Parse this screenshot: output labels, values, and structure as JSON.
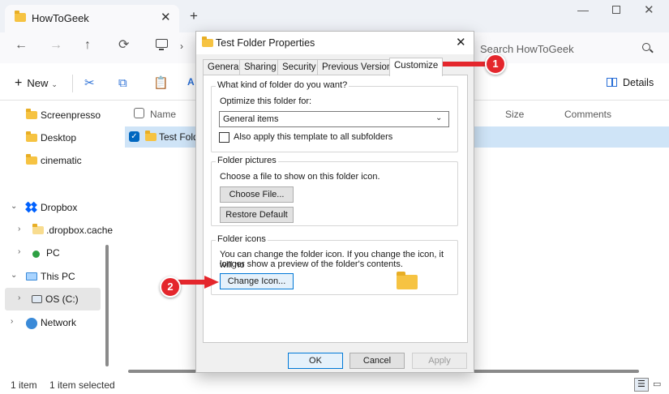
{
  "explorer": {
    "tab_title": "HowToGeek",
    "tab_close": "✕",
    "new_tab": "+",
    "window_controls": {
      "minimize": "—",
      "close": "✕"
    },
    "nav": {
      "back": "←",
      "forward": "→",
      "up": "↑",
      "refresh": "⟳",
      "breadcrumb_chevron": "›"
    },
    "search_placeholder": "Search HowToGeek",
    "toolbar": {
      "new_label": "New",
      "new_plus": "+",
      "new_caret": "⌄",
      "cut": "✂",
      "copy": "⧉",
      "paste": "📋",
      "rename": "A",
      "details_label": "Details"
    },
    "sidebar": [
      {
        "label": "Screenpresso",
        "icon": "folder-icon"
      },
      {
        "label": "Desktop",
        "icon": "folder-icon"
      },
      {
        "label": "cinematic",
        "icon": "folder-icon"
      },
      {
        "label": "Dropbox",
        "icon": "dropbox-icon",
        "chevron": "⌄"
      },
      {
        "label": ".dropbox.cache",
        "icon": "folder-icon",
        "chevron": "›"
      },
      {
        "label": "PC",
        "icon": "pc-icon",
        "chevron": "›"
      },
      {
        "label": "This PC",
        "icon": "computer-icon",
        "chevron": "⌄"
      },
      {
        "label": "OS (C:)",
        "icon": "drive-icon",
        "chevron": "›"
      },
      {
        "label": "Network",
        "icon": "network-icon",
        "chevron": "›"
      }
    ],
    "columns": {
      "name": "Name",
      "size": "Size",
      "comments": "Comments"
    },
    "rows": [
      {
        "name": "Test Folder",
        "checked": "✓"
      }
    ],
    "status": {
      "count": "1 item",
      "selected": "1 item selected"
    },
    "colors": {
      "accent": "#0067c0",
      "selection": "#cfe4f7",
      "folder": "#f6c342"
    }
  },
  "dialog": {
    "title": "Test Folder Properties",
    "close": "✕",
    "tabs": [
      "General",
      "Sharing",
      "Security",
      "Previous Versions",
      "Customize"
    ],
    "active_tab": "Customize",
    "folder_type": {
      "label": "What kind of folder do you want?",
      "optimize_label": "Optimize this folder for:",
      "selected": "General items",
      "caret": "⌄",
      "subfolders_checkbox": "Also apply this template to all subfolders"
    },
    "folder_pictures": {
      "label": "Folder pictures",
      "text": "Choose a file to show on this folder icon.",
      "choose_file": "Choose File...",
      "restore_default": "Restore Default"
    },
    "folder_icons": {
      "label": "Folder icons",
      "text_line1": "You can change the folder icon. If you change the icon, it will no",
      "text_line2": "longer show a preview of the folder's contents.",
      "change_icon": "Change Icon..."
    },
    "buttons": {
      "ok": "OK",
      "cancel": "Cancel",
      "apply": "Apply"
    }
  },
  "annotations": [
    {
      "number": "1",
      "color": "#e4262c"
    },
    {
      "number": "2",
      "color": "#e4262c"
    }
  ]
}
